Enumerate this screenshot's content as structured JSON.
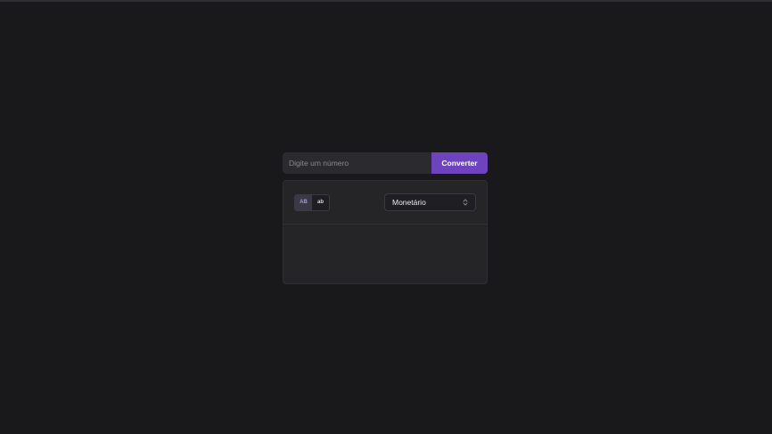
{
  "converter": {
    "input_placeholder": "Digite um número",
    "input_value": "",
    "convert_label": "Converter"
  },
  "options": {
    "uppercase_label": "AB",
    "lowercase_label": "ab",
    "active_case": "uppercase",
    "mode_selected": "Monetário",
    "mode_icon": "chevron-up-down-icon"
  },
  "output": {
    "text": ""
  },
  "colors": {
    "background": "#19181b",
    "panel": "#252427",
    "accent": "#6e44be",
    "active_text": "#a993e8"
  }
}
